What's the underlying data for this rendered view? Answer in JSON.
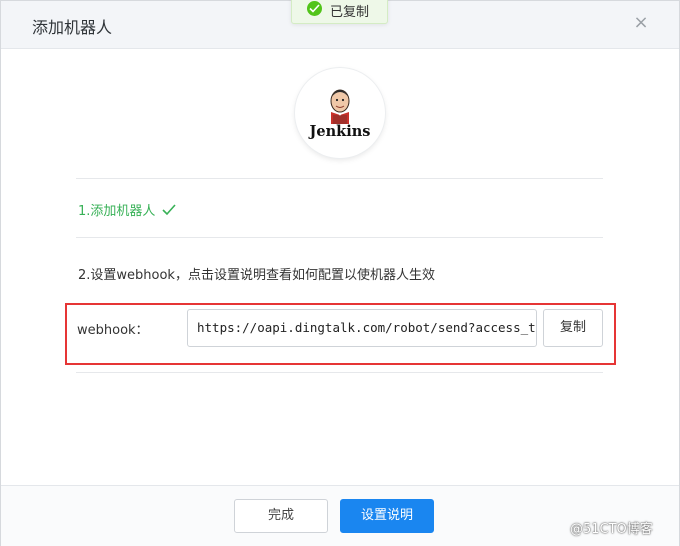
{
  "dialog": {
    "title": "添加机器人",
    "close_symbol": "×",
    "close_icon": "close-icon"
  },
  "toast": {
    "message": "已复制",
    "icon": "check-circle-icon",
    "color": "#52c41a"
  },
  "logo": {
    "wordmark": "Jenkins",
    "icon": "jenkins-butler-icon"
  },
  "steps": {
    "step1": "1.添加机器人",
    "step1_done_icon": "checkmark-icon",
    "step1_color": "#38b157",
    "step2": "2.设置webhook，点击设置说明查看如何配置以使机器人生效"
  },
  "webhook": {
    "label": "webhook：",
    "value": "https://oapi.dingtalk.com/robot/send?access_tok",
    "copy_label": "复制"
  },
  "footer": {
    "done_label": "完成",
    "setup_label": "设置说明",
    "primary_color": "#1a86f0"
  },
  "watermark": "@51CTO博客",
  "highlight_color": "#e63535"
}
